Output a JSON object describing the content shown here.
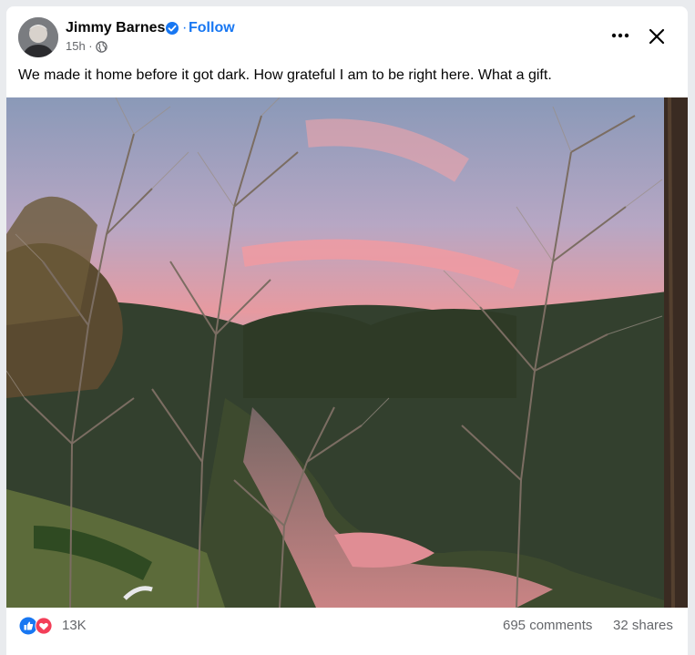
{
  "post": {
    "author": "Jimmy Barnes",
    "separator": "·",
    "follow_label": "Follow",
    "time": "15h ·",
    "text": "We made it home before it got dark. How grateful I am to be right here. What a gift."
  },
  "icons": {
    "verified": "verified-badge-icon",
    "audience": "globe-icon",
    "more": "more-options-icon",
    "close": "close-icon",
    "like": "like-icon",
    "love": "love-icon"
  },
  "colors": {
    "accent": "#1877f2",
    "like": "#1877f2",
    "love": "#f33e58",
    "secondary_text": "#65676b"
  },
  "stats": {
    "reactions": "13K",
    "comments": "695 comments",
    "shares": "32 shares"
  }
}
